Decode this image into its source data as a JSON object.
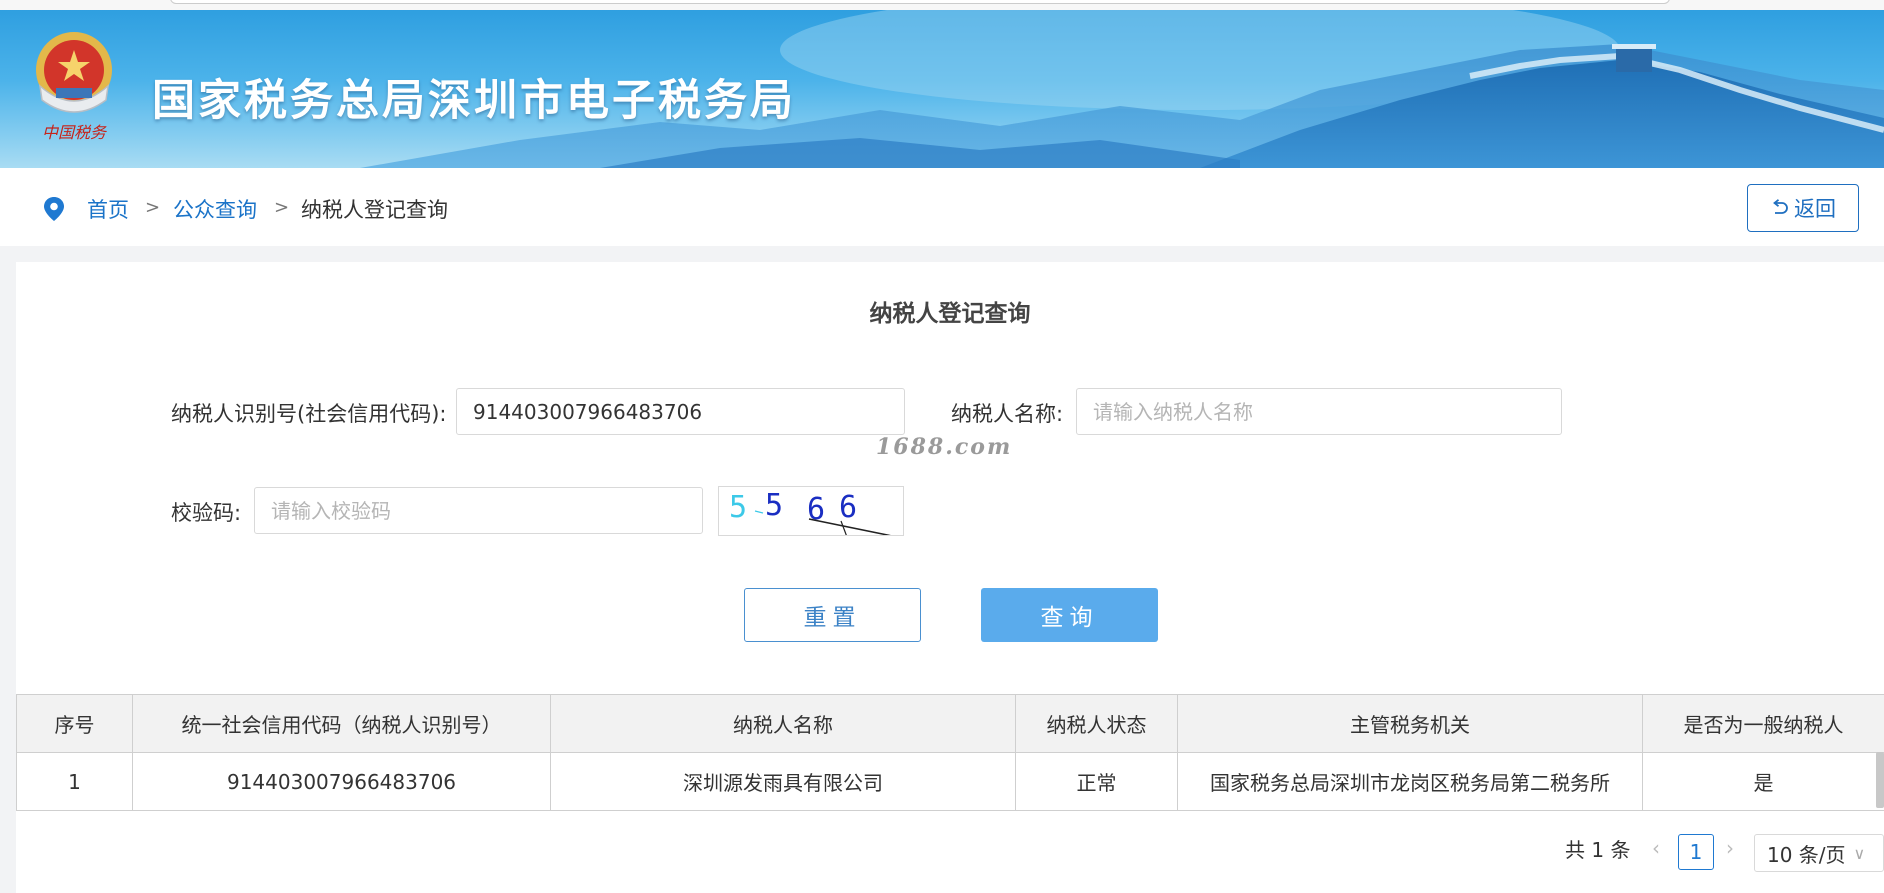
{
  "banner": {
    "site_title": "国家税务总局深圳市电子税务局",
    "emblem_icon": "tax-emblem-icon",
    "emblem_caption": "中国税务"
  },
  "breadcrumb": {
    "items": [
      "首页",
      "公众查询",
      "纳税人登记查询"
    ],
    "separator": ">",
    "location_icon": "map-pin-icon"
  },
  "back_button": {
    "label": "返回",
    "icon": "undo-arrow-icon"
  },
  "page_title": "纳税人登记查询",
  "form": {
    "taxpayer_id_label": "纳税人识别号(社会信用代码):",
    "taxpayer_id_value": "914403007966483706",
    "taxpayer_name_label": "纳税人名称:",
    "taxpayer_name_placeholder": "请输入纳税人名称",
    "captcha_label": "校验码:",
    "captcha_placeholder": "请输入校验码",
    "captcha_text": "5566"
  },
  "watermark": "1688.com",
  "buttons": {
    "reset": "重置",
    "query": "查询"
  },
  "table": {
    "columns": [
      "序号",
      "统一社会信用代码（纳税人识别号）",
      "纳税人名称",
      "纳税人状态",
      "主管税务机关",
      "是否为一般纳税人"
    ],
    "rows": [
      [
        "1",
        "914403007966483706",
        "深圳源发雨具有限公司",
        "正常",
        "国家税务总局深圳市龙岗区税务局第二税务所",
        "是"
      ]
    ]
  },
  "pagination": {
    "total_text": "共 1 条",
    "current_page": "1",
    "page_size": "10 条/页"
  },
  "colors": {
    "banner_blue": "#2f9fe0",
    "link_blue": "#1a73c8",
    "query_button": "#5aabec"
  }
}
